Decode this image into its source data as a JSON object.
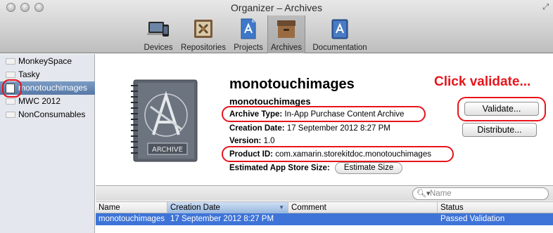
{
  "window": {
    "title": "Organizer – Archives"
  },
  "toolbar": {
    "items": [
      {
        "label": "Devices",
        "icon": "devices-icon"
      },
      {
        "label": "Repositories",
        "icon": "repositories-icon"
      },
      {
        "label": "Projects",
        "icon": "projects-icon"
      },
      {
        "label": "Archives",
        "icon": "archives-icon",
        "selected": true
      },
      {
        "label": "Documentation",
        "icon": "documentation-icon"
      }
    ]
  },
  "sidebar": {
    "items": [
      {
        "label": "MonkeySpace"
      },
      {
        "label": "Tasky"
      },
      {
        "label": "monotouchimages",
        "selected": true
      },
      {
        "label": "MWC 2012"
      },
      {
        "label": "NonConsumables"
      }
    ]
  },
  "detail": {
    "title": "monotouchimages",
    "name": "monotouchimages",
    "archive_type_label": "Archive Type:",
    "archive_type_value": "In-App Purchase Content Archive",
    "creation_date_label": "Creation Date:",
    "creation_date_value": "17 September 2012 8:27 PM",
    "version_label": "Version:",
    "version_value": "1.0",
    "product_id_label": "Product ID:",
    "product_id_value": "com.xamarin.storekitdoc.monotouchimages",
    "estimated_size_label": "Estimated App Store Size:",
    "estimate_button": "Estimate Size",
    "validate_button": "Validate...",
    "distribute_button": "Distribute...",
    "archive_badge_text": "ARCHIVE"
  },
  "annotation": {
    "text": "Click validate...",
    "color": "#e8141c"
  },
  "search": {
    "placeholder": "Name",
    "value": ""
  },
  "table": {
    "columns": [
      "Name",
      "Creation Date",
      "Comment",
      "Status"
    ],
    "sorted_column": "Creation Date",
    "rows": [
      {
        "name": "monotouchimages",
        "creation_date": "17 September 2012 8:27 PM",
        "comment": "",
        "status": "Passed Validation"
      }
    ]
  },
  "colors": {
    "selection": "#3e74d7",
    "sidebar_selection": "#5d7fad",
    "annotation_red": "#e8141c"
  }
}
